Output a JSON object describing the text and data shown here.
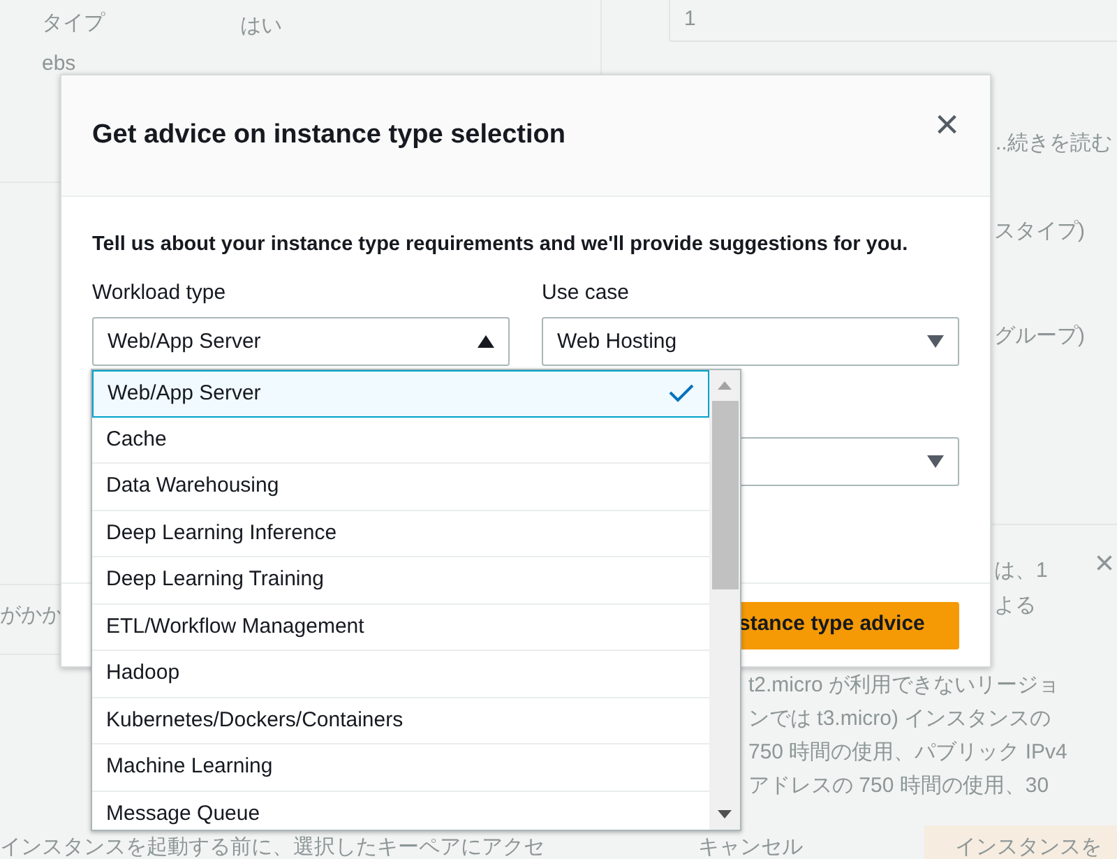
{
  "background_page": {
    "summary_row": {
      "label": "タイプ",
      "value": "はい"
    },
    "ebs_label": "ebs",
    "quantity_field": {
      "value": "1"
    },
    "read_more": "..続きを読む",
    "hint_1": "スタイプ)",
    "hint_2": "グループ)",
    "free_tier_notice": {
      "head_lines": [
        "は、1",
        "よる"
      ],
      "body_lines": [
        "t2.micro が利用できないリージョ",
        "ンでは t3.micro) インスタンスの",
        "750 時間の使用、パブリック IPv4",
        "アドレスの 750 時間の使用、30"
      ]
    },
    "left_fragment": "がかか",
    "key_pair_note": "インスタンスを起動する前に、選択したキーペアにアクセ",
    "cancel_button": "キャンセル",
    "launch_button": "インスタンスを",
    "notice_close": "×"
  },
  "modal": {
    "title": "Get advice on instance type selection",
    "close": "×",
    "intro": "Tell us about your instance type requirements and we'll provide suggestions for you.",
    "workload_type": {
      "label": "Workload type",
      "value": "Web/App Server",
      "expanded": true
    },
    "use_case": {
      "label": "Use case",
      "value": "Web Hosting",
      "expanded": false
    },
    "submit_button": "stance type advice",
    "workload_options": [
      {
        "label": "Web/App Server",
        "selected": true
      },
      {
        "label": "Cache",
        "selected": false
      },
      {
        "label": "Data Warehousing",
        "selected": false
      },
      {
        "label": "Deep Learning Inference",
        "selected": false
      },
      {
        "label": "Deep Learning Training",
        "selected": false
      },
      {
        "label": "ETL/Workflow Management",
        "selected": false
      },
      {
        "label": "Hadoop",
        "selected": false
      },
      {
        "label": "Kubernetes/Dockers/Containers",
        "selected": false
      },
      {
        "label": "Machine Learning",
        "selected": false
      },
      {
        "label": "Message Queue",
        "selected": false
      }
    ]
  }
}
